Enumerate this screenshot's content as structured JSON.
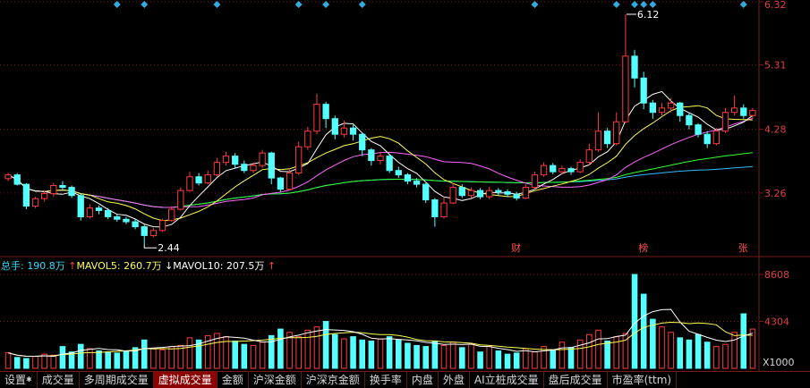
{
  "tabs": [
    {
      "label": "设置",
      "gear": true
    },
    {
      "label": "成交量"
    },
    {
      "label": "多周期成交量"
    },
    {
      "label": "虚拟成交量",
      "active": true
    },
    {
      "label": "金额"
    },
    {
      "label": "沪深金额"
    },
    {
      "label": "沪深京金额"
    },
    {
      "label": "换手率"
    },
    {
      "label": "内盘"
    },
    {
      "label": "外盘"
    },
    {
      "label": "AI立桩成交量"
    },
    {
      "label": "盘后成交量"
    },
    {
      "label": "市盈率(ttm)"
    }
  ],
  "colors": {
    "up": "#ff3c3c",
    "down": "#54ffff",
    "ma5": "#ffffff",
    "ma10": "#ffff55",
    "ma20": "#ff66ff",
    "ma60": "#33ff33",
    "ma120": "#33bbff",
    "grid": "#7a1a1a",
    "axis_text": "#e04040"
  },
  "chart_data": [
    {
      "type": "candlestick",
      "price_ticks": [
        "6.32",
        "5.31",
        "4.28",
        "3.26"
      ],
      "ylim": [
        2.3,
        6.32
      ],
      "high_label": "6.12",
      "low_label": "2.44",
      "event_markers": [
        "财",
        "榜",
        "张"
      ],
      "top_markers_count": 12,
      "candles": [
        [
          3.49,
          3.55,
          3.58,
          3.45
        ],
        [
          3.55,
          3.4,
          3.58,
          3.38
        ],
        [
          3.4,
          3.05,
          3.42,
          3.0
        ],
        [
          3.05,
          3.17,
          3.2,
          3.02
        ],
        [
          3.17,
          3.25,
          3.3,
          3.12
        ],
        [
          3.25,
          3.38,
          3.42,
          3.2
        ],
        [
          3.38,
          3.35,
          3.45,
          3.3
        ],
        [
          3.35,
          3.22,
          3.38,
          3.18
        ],
        [
          3.22,
          2.88,
          3.25,
          2.82
        ],
        [
          2.88,
          3.02,
          3.08,
          2.85
        ],
        [
          3.02,
          2.98,
          3.06,
          2.92
        ],
        [
          2.98,
          2.88,
          3.02,
          2.84
        ],
        [
          2.88,
          2.84,
          2.92,
          2.8
        ],
        [
          2.84,
          2.8,
          2.88,
          2.76
        ],
        [
          2.8,
          2.72,
          2.84,
          2.68
        ],
        [
          2.72,
          2.58,
          2.75,
          2.44
        ],
        [
          2.58,
          2.66,
          2.7,
          2.55
        ],
        [
          2.66,
          2.82,
          2.85,
          2.64
        ],
        [
          2.82,
          3.0,
          3.05,
          2.8
        ],
        [
          3.0,
          3.3,
          3.35,
          2.98
        ],
        [
          3.3,
          3.52,
          3.6,
          3.28
        ],
        [
          3.52,
          3.42,
          3.58,
          3.38
        ],
        [
          3.42,
          3.55,
          3.62,
          3.4
        ],
        [
          3.55,
          3.75,
          3.82,
          3.52
        ],
        [
          3.75,
          3.85,
          3.92,
          3.7
        ],
        [
          3.85,
          3.72,
          3.9,
          3.65
        ],
        [
          3.72,
          3.62,
          3.78,
          3.58
        ],
        [
          3.62,
          3.7,
          3.75,
          3.58
        ],
        [
          3.7,
          3.9,
          3.95,
          3.66
        ],
        [
          3.9,
          3.5,
          3.92,
          3.4
        ],
        [
          3.5,
          3.32,
          3.52,
          3.28
        ],
        [
          3.32,
          3.58,
          3.65,
          3.3
        ],
        [
          3.58,
          4.0,
          4.08,
          3.55
        ],
        [
          4.0,
          4.25,
          4.32,
          3.95
        ],
        [
          4.25,
          4.68,
          4.85,
          4.2
        ],
        [
          4.68,
          4.45,
          4.72,
          4.3
        ],
        [
          4.45,
          4.2,
          4.5,
          4.12
        ],
        [
          4.2,
          4.3,
          4.42,
          4.15
        ],
        [
          4.3,
          4.2,
          4.35,
          4.1
        ],
        [
          4.2,
          3.95,
          4.22,
          3.85
        ],
        [
          3.95,
          3.78,
          3.98,
          3.7
        ],
        [
          3.78,
          3.85,
          3.92,
          3.72
        ],
        [
          3.85,
          3.62,
          3.88,
          3.58
        ],
        [
          3.62,
          3.55,
          3.68,
          3.5
        ],
        [
          3.55,
          3.45,
          3.58,
          3.4
        ],
        [
          3.45,
          3.4,
          3.5,
          3.35
        ],
        [
          3.4,
          3.15,
          3.42,
          3.1
        ],
        [
          3.15,
          2.88,
          3.18,
          2.72
        ],
        [
          2.88,
          3.1,
          3.2,
          2.85
        ],
        [
          3.1,
          3.35,
          3.42,
          3.08
        ],
        [
          3.35,
          3.22,
          3.4,
          3.18
        ],
        [
          3.22,
          3.3,
          3.35,
          3.18
        ],
        [
          3.3,
          3.2,
          3.34,
          3.16
        ],
        [
          3.2,
          3.3,
          3.36,
          3.16
        ],
        [
          3.3,
          3.28,
          3.34,
          3.22
        ],
        [
          3.28,
          3.24,
          3.32,
          3.2
        ],
        [
          3.24,
          3.18,
          3.28,
          3.14
        ],
        [
          3.18,
          3.35,
          3.4,
          3.16
        ],
        [
          3.35,
          3.55,
          3.6,
          3.32
        ],
        [
          3.55,
          3.7,
          3.75,
          3.52
        ],
        [
          3.7,
          3.6,
          3.74,
          3.56
        ],
        [
          3.6,
          3.65,
          3.7,
          3.56
        ],
        [
          3.65,
          3.6,
          3.68,
          3.55
        ],
        [
          3.6,
          3.75,
          3.8,
          3.58
        ],
        [
          3.75,
          3.95,
          4.05,
          3.7
        ],
        [
          3.95,
          4.25,
          4.55,
          3.92
        ],
        [
          4.25,
          4.05,
          4.3,
          3.98
        ],
        [
          4.05,
          4.4,
          4.55,
          4.02
        ],
        [
          4.4,
          5.45,
          6.12,
          4.38
        ],
        [
          5.45,
          5.1,
          5.55,
          4.95
        ],
        [
          5.1,
          4.7,
          5.2,
          4.6
        ],
        [
          4.7,
          4.55,
          4.75,
          4.45
        ],
        [
          4.55,
          4.62,
          4.7,
          4.5
        ],
        [
          4.62,
          4.7,
          4.78,
          4.55
        ],
        [
          4.7,
          4.5,
          4.72,
          4.4
        ],
        [
          4.5,
          4.35,
          4.55,
          4.28
        ],
        [
          4.35,
          4.2,
          4.38,
          4.15
        ],
        [
          4.2,
          4.05,
          4.25,
          3.98
        ],
        [
          4.05,
          4.25,
          4.3,
          4.02
        ],
        [
          4.25,
          4.55,
          4.62,
          4.22
        ],
        [
          4.55,
          4.62,
          4.82,
          4.5
        ],
        [
          4.62,
          4.5,
          4.68,
          4.45
        ],
        [
          4.5,
          4.58,
          4.62,
          4.45
        ]
      ]
    },
    {
      "type": "bar",
      "legend": {
        "total_label": "总手:",
        "total_value": "190.8万",
        "ma5_label": "MAVOL5:",
        "ma5_value": "260.7万",
        "ma10_label": "MAVOL10:",
        "ma10_value": "207.5万"
      },
      "ticks": [
        "8608",
        "4304"
      ],
      "unit_label": "X1000",
      "ylim": [
        0,
        8608
      ],
      "values": [
        1420,
        1000,
        900,
        1100,
        1300,
        1200,
        2000,
        1500,
        2200,
        1800,
        1600,
        1500,
        1400,
        1600,
        1900,
        2600,
        1800,
        1700,
        2000,
        2100,
        2800,
        2600,
        3000,
        3200,
        2900,
        2500,
        2200,
        2100,
        2400,
        3000,
        3600,
        3300,
        2900,
        3500,
        3800,
        4300,
        3100,
        2700,
        2900,
        2600,
        2500,
        2700,
        2900,
        2600,
        2300,
        2100,
        2000,
        2500,
        2100,
        2400,
        1900,
        2200,
        1500,
        2000,
        1600,
        1300,
        1400,
        1800,
        1500,
        2000,
        1700,
        2400,
        1900,
        2600,
        3100,
        3500,
        2500,
        2900,
        3200,
        8608,
        6800,
        4500,
        3800,
        3300,
        2800,
        2600,
        3100,
        2400,
        2000,
        2200,
        3300,
        5000,
        3600
      ]
    }
  ]
}
